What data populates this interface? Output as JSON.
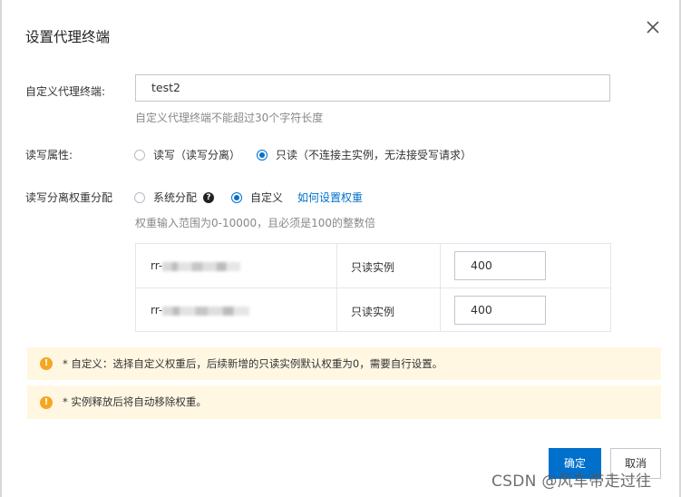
{
  "dialog": {
    "title": "设置代理终端",
    "close_icon": "close-icon"
  },
  "form": {
    "name_label": "自定义代理终端:",
    "name_value": "test2",
    "name_hint": "自定义代理终端不能超过30个字符长度",
    "rw_label": "读写属性:",
    "rw_options": [
      {
        "label": "读写（读写分离）",
        "selected": false
      },
      {
        "label": "只读（不连接主实例，无法接受写请求）",
        "selected": true
      }
    ],
    "weight_label": "读写分离权重分配",
    "weight_options": [
      {
        "label": "系统分配",
        "selected": false
      },
      {
        "label": "自定义",
        "selected": true
      }
    ],
    "weight_link": "如何设置权重",
    "weight_hint": "权重输入范围为0-10000，且必须是100的整数倍",
    "weight_rows": [
      {
        "id_prefix": "rr-",
        "type": "只读实例",
        "weight": "400"
      },
      {
        "id_prefix": "rr-",
        "type": "只读实例",
        "weight": "400"
      }
    ]
  },
  "notices": [
    "* 自定义：选择自定义权重后，后续新增的只读实例默认权重为0，需要自行设置。",
    "* 实例释放后将自动移除权重。"
  ],
  "footer": {
    "ok_label": "确定",
    "cancel_label": "取消"
  },
  "watermark": "CSDN @风车带走过往",
  "colors": {
    "accent": "#0070cc",
    "notice_bg": "#fff7e2",
    "warn": "#f5a623"
  }
}
